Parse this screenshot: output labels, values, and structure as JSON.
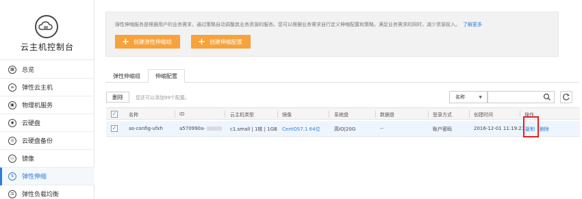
{
  "sidebar": {
    "title": "云主机控制台",
    "items": [
      {
        "label": "总览",
        "icon": "overview-icon"
      },
      {
        "label": "弹性云主机",
        "icon": "cloud-host-icon"
      },
      {
        "label": "物理机服务",
        "icon": "physical-machine-icon"
      },
      {
        "label": "云硬盘",
        "icon": "disk-icon"
      },
      {
        "label": "云硬盘备份",
        "icon": "disk-backup-icon"
      },
      {
        "label": "镜像",
        "icon": "image-icon"
      },
      {
        "label": "弹性伸缩",
        "icon": "autoscaling-icon",
        "active": true
      },
      {
        "label": "弹性负载均衡",
        "icon": "load-balancer-icon"
      }
    ]
  },
  "notice": {
    "text": "弹性伸缩服务是根据用户的业务需求，通过策略自动调整其业务资源的服务。您可以根据业务需求自行定义伸缩配置和策略，满足业务需求的同时，减少资源投入。",
    "link": "了解更多"
  },
  "actions": {
    "create_group": "创建弹性伸缩组",
    "create_config": "创建伸缩配置"
  },
  "tabs": [
    {
      "label": "弹性伸缩组"
    },
    {
      "label": "伸缩配置",
      "active": true
    }
  ],
  "toolbar": {
    "delete_label": "删除",
    "hint": "您还可以添加99个配置。",
    "filter_selected": "名称",
    "search_placeholder": ""
  },
  "table": {
    "headers": [
      "名称",
      "ID",
      "云主机类型",
      "镜像",
      "系统盘",
      "数据盘",
      "登录方式",
      "创建时间",
      "操作"
    ],
    "rows": [
      {
        "name": "as-config-ufxh",
        "id": "a570990a-",
        "type": "c1.small | 1核 | 1GB",
        "image": "CentOS7.1 64位",
        "system_disk": "高IO|20G",
        "data_disk": "--",
        "login": "账户密码",
        "created": "2016-12-01 11:19:21...",
        "copy": "复制",
        "delete": "删除"
      }
    ]
  },
  "colors": {
    "accent": "#2e7cd6",
    "orange": "#f7a23b",
    "highlight": "#e02020"
  }
}
